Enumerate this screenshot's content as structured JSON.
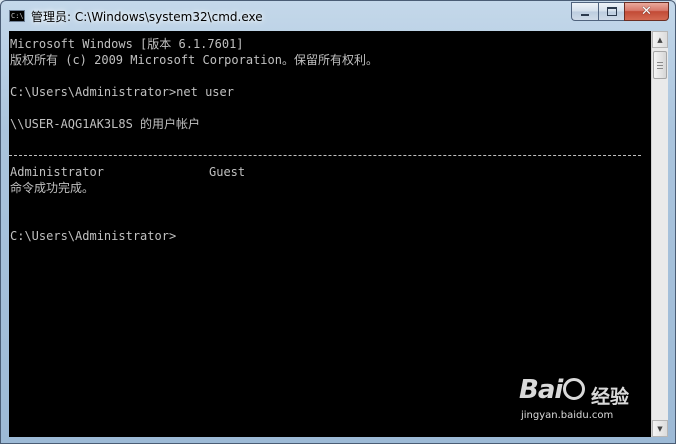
{
  "window": {
    "title": "管理员: C:\\Windows\\system32\\cmd.exe",
    "icon": "cmd-app-icon",
    "icon_text": "C:\\",
    "controls": {
      "minimize_icon": "minimize-icon",
      "maximize_icon": "maximize-icon",
      "close_icon": "close-icon",
      "close_glyph": "✕"
    }
  },
  "console": {
    "lines": [
      "Microsoft Windows [版本 6.1.7601]",
      "版权所有 (c) 2009 Microsoft Corporation。保留所有权利。",
      "C:\\Users\\Administrator>net user",
      "\\\\USER-AQG1AK3L8S 的用户帐户",
      "Administrator",
      "命令成功完成。",
      "C:\\Users\\Administrator>"
    ],
    "user_col2": "Guest",
    "background": "#000000",
    "foreground": "#c0c0c0"
  },
  "scrollbar": {
    "up_glyph": "▲",
    "down_glyph": "▼"
  },
  "watermark": {
    "logo_left": "Bai",
    "logo_right": "",
    "brand_cn": "经验",
    "url": "jingyan.baidu.com"
  }
}
